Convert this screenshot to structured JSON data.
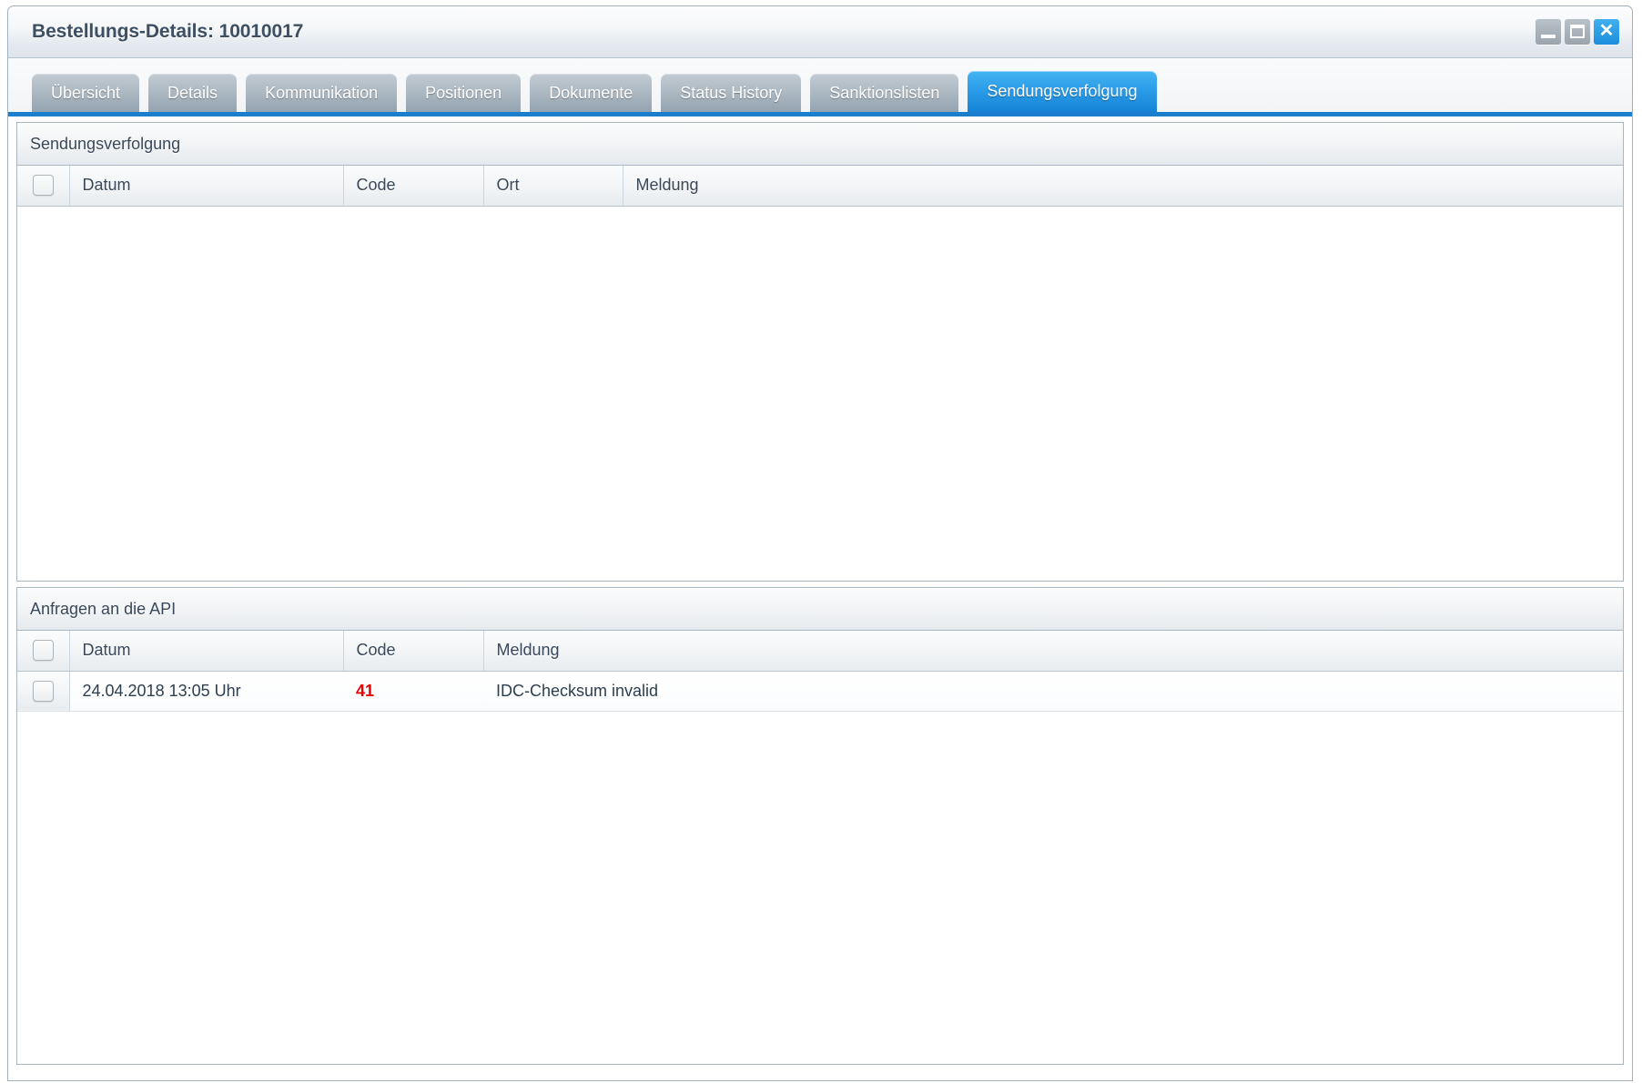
{
  "window": {
    "title": "Bestellungs-Details: 10010017",
    "controls": [
      {
        "name": "minimize-button",
        "icon": "minimize-icon",
        "style": "gray"
      },
      {
        "name": "restore-button",
        "icon": "restore-icon",
        "style": "gray"
      },
      {
        "name": "close-button",
        "icon": "close-icon",
        "style": "blue",
        "glyph": "✕"
      }
    ]
  },
  "tabs": [
    {
      "label": "Übersicht",
      "active": false
    },
    {
      "label": "Details",
      "active": false
    },
    {
      "label": "Kommunikation",
      "active": false
    },
    {
      "label": "Positionen",
      "active": false
    },
    {
      "label": "Dokumente",
      "active": false
    },
    {
      "label": "Status History",
      "active": false
    },
    {
      "label": "Sanktionslisten",
      "active": false
    },
    {
      "label": "Sendungsverfolgung",
      "active": true
    }
  ],
  "panels": {
    "tracking": {
      "title": "Sendungsverfolgung",
      "columns": [
        "Datum",
        "Code",
        "Ort",
        "Meldung"
      ],
      "rows": []
    },
    "api": {
      "title": "Anfragen an die API",
      "columns": [
        "Datum",
        "Code",
        "Meldung"
      ],
      "rows": [
        {
          "datum": "24.04.2018 13:05 Uhr",
          "code": "41",
          "meldung": "IDC-Checksum invalid"
        }
      ]
    }
  },
  "colors": {
    "accent_blue": "#1b7fcd",
    "active_tab_blue": "#2b9ce8",
    "error_red": "#e60000",
    "title_text": "#3d4f63",
    "panel_border": "#a7b7c4"
  }
}
